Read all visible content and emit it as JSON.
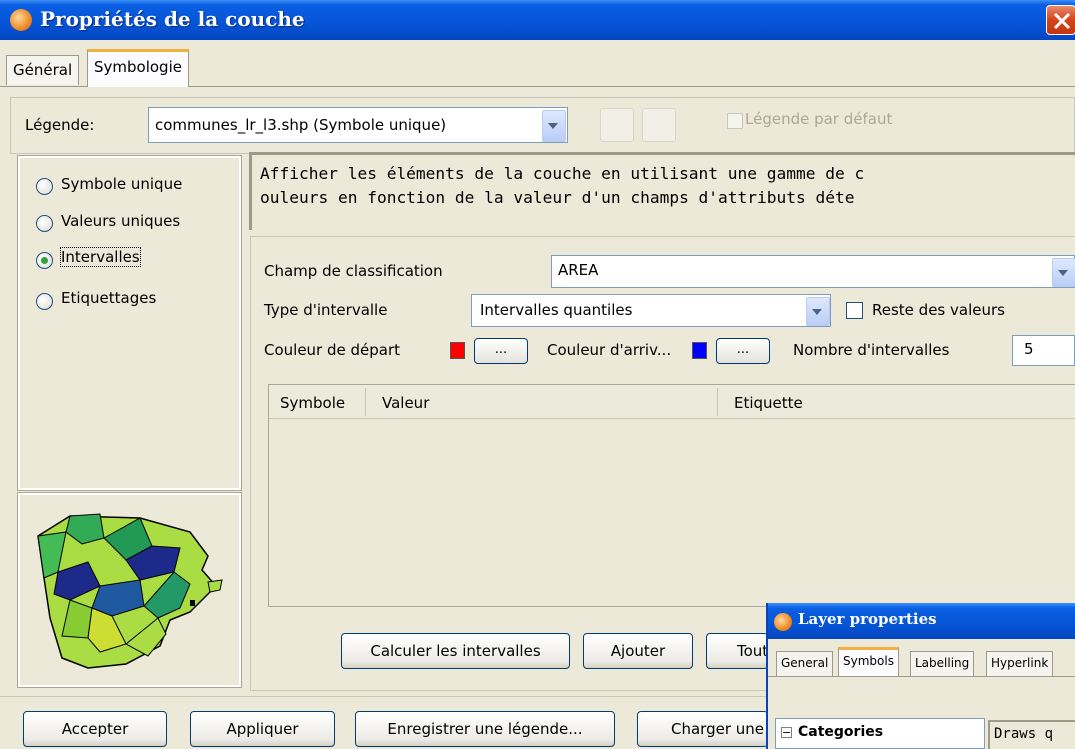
{
  "window": {
    "title": "Propriétés de la couche"
  },
  "tabs": [
    {
      "label": "Général"
    },
    {
      "label": "Symbologie"
    }
  ],
  "legend": {
    "label": "Légende:",
    "value": "communes_lr_l3.shp (Symbole unique)",
    "default_checkbox_label": "Légende par défaut"
  },
  "legend_types": [
    {
      "label": "Symbole unique",
      "selected": false
    },
    {
      "label": "Valeurs uniques",
      "selected": false
    },
    {
      "label": "Intervalles",
      "selected": true
    },
    {
      "label": "Etiquettages",
      "selected": false
    }
  ],
  "description": {
    "line1": "Afficher les éléments de la couche en utilisant une gamme de c",
    "line2": "ouleurs en fonction de la valeur d'un champs d'attributs déte"
  },
  "form": {
    "field_label": "Champ de classification",
    "field_value": "AREA",
    "type_label": "Type d'intervalle",
    "type_value": "Intervalles quantiles",
    "rest_label": "Reste des valeurs",
    "start_color_label": "Couleur de départ",
    "start_color": "#ff0000",
    "end_color_label": "Couleur d'arriv...",
    "end_color": "#0000ff",
    "ellipsis": "...",
    "count_label": "Nombre d'intervalles",
    "count_value": "5"
  },
  "table": {
    "columns": [
      "Symbole",
      "Valeur",
      "Etiquette"
    ]
  },
  "actions": {
    "compute": "Calculer les intervalles",
    "add": "Ajouter",
    "all": "Tout"
  },
  "footer": {
    "accept": "Accepter",
    "apply": "Appliquer",
    "save_legend": "Enregistrer une légende...",
    "load_legend": "Charger une"
  },
  "overlay": {
    "title": "Layer properties",
    "tabs": [
      "General",
      "Symbols",
      "Labelling",
      "Hyperlink"
    ],
    "tree_item": "Categories",
    "description": "Draws q"
  },
  "colors": {
    "titlebar": "#0554d6",
    "dialog_bg": "#ece9d8",
    "radio_selected": "#37a038"
  }
}
